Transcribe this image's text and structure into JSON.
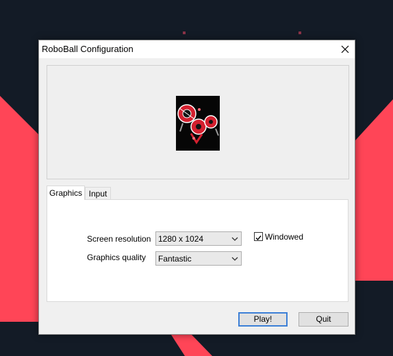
{
  "window": {
    "title": "RoboBall Configuration"
  },
  "tabs": [
    {
      "label": "Graphics",
      "active": true
    },
    {
      "label": "Input",
      "active": false
    }
  ],
  "graphics": {
    "resolution_label": "Screen resolution",
    "resolution_value": "1280 x 1024",
    "quality_label": "Graphics quality",
    "quality_value": "Fantastic",
    "windowed_label": "Windowed",
    "windowed_checked": true
  },
  "buttons": {
    "play_label": "Play!",
    "quit_label": "Quit"
  },
  "colors": {
    "background": "#131b26",
    "accent_red": "#ff4557",
    "focus_blue": "#3c7fd6"
  }
}
